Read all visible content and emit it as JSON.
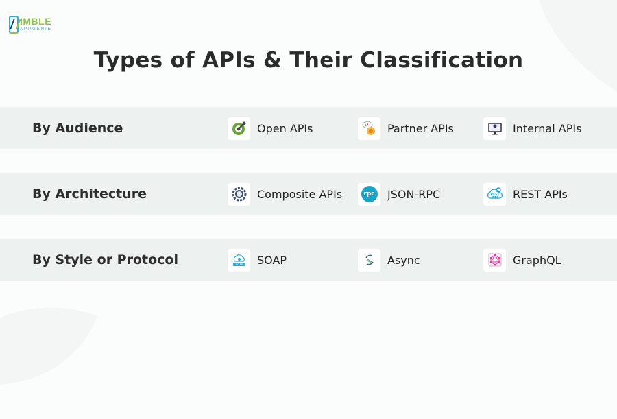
{
  "logo": {
    "word": "IMBLE",
    "sub": "APPGENIE"
  },
  "title": "Types of APIs & Their Classification",
  "rows": [
    {
      "label": "By Audience",
      "items": [
        {
          "label": "Open APIs",
          "icon": "openapi-icon"
        },
        {
          "label": "Partner APIs",
          "icon": "partner-api-icon"
        },
        {
          "label": "Internal APIs",
          "icon": "internal-api-icon"
        }
      ]
    },
    {
      "label": "By Architecture",
      "items": [
        {
          "label": "Composite APIs",
          "icon": "composite-api-icon"
        },
        {
          "label": "JSON-RPC",
          "icon": "rpc-icon"
        },
        {
          "label": "REST APIs",
          "icon": "rest-api-icon"
        }
      ]
    },
    {
      "label": "By Style or Protocol",
      "items": [
        {
          "label": "SOAP",
          "icon": "soap-icon"
        },
        {
          "label": "Async",
          "icon": "async-icon"
        },
        {
          "label": "GraphQL",
          "icon": "graphql-icon"
        }
      ]
    }
  ],
  "icon_text": {
    "rpc": "rpc",
    "rest_top": "REST",
    "rest_bottom": "API",
    "soap": "SOAP",
    "api": "API"
  },
  "colors": {
    "logo_green": "#8cc63f",
    "logo_blue": "#3aa8d8",
    "row_bg": "#edf1f0",
    "rpc_blue": "#1aa3c9",
    "graphql_pink": "#e535ab"
  }
}
